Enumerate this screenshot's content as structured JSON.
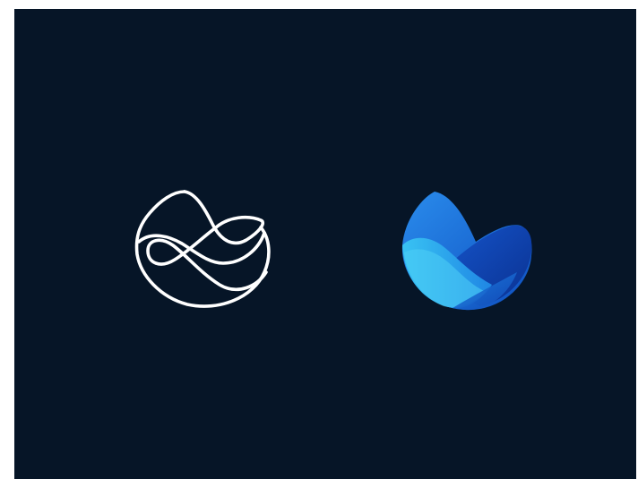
{
  "canvas": {
    "background": "#061527"
  },
  "logos": {
    "outline": {
      "icon": "wave-bowl-outline-icon",
      "stroke_color": "#ffffff"
    },
    "filled": {
      "icon": "wave-bowl-filled-icon",
      "colors": {
        "dark_blue": "#0d3fa8",
        "mid_blue": "#1a72d8",
        "light_blue": "#2cb2f0",
        "cyan": "#4fd0f5",
        "deep_blue": "#0b2f8a"
      }
    }
  }
}
